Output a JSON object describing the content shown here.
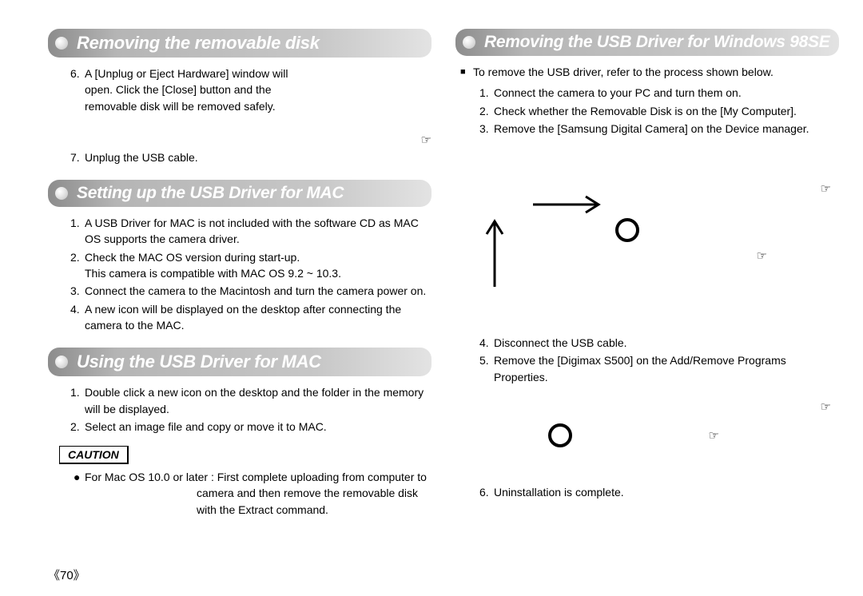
{
  "page_number_display": "《70》",
  "left": {
    "s1": {
      "title": "Removing the removable disk",
      "i6n": "6.",
      "i6": "A [Unplug or Eject Hardware] window will open. Click the [Close] button and the removable disk will be removed safely.",
      "i7n": "7.",
      "i7": "Unplug the USB cable."
    },
    "s2": {
      "title": "Setting up the USB Driver for MAC",
      "i1n": "1.",
      "i1": "A USB Driver for MAC is not included with the software CD as MAC OS supports the camera driver.",
      "i2n": "2.",
      "i2a": "Check the MAC OS version during start-up.",
      "i2b": "This camera is compatible with MAC OS 9.2 ~ 10.3.",
      "i3n": "3.",
      "i3": "Connect the camera to the Macintosh and turn the camera power on.",
      "i4n": "4.",
      "i4": "A new icon will be displayed on the desktop after connecting the camera to the MAC."
    },
    "s3": {
      "title": "Using the USB Driver for MAC",
      "i1n": "1.",
      "i1": "Double click a new icon on the desktop and the folder in the memory will be displayed.",
      "i2n": "2.",
      "i2": "Select an image file and copy or move it to MAC."
    },
    "caution": {
      "label": "CAUTION",
      "bullet": "●",
      "line1": "For Mac OS 10.0 or later : First complete uploading from computer to",
      "line2": "camera and then remove the removable disk",
      "line3": "with the Extract command."
    }
  },
  "right": {
    "s1": {
      "title": "Removing the USB Driver for Windows 98SE",
      "lead_sq": "■",
      "lead": "To remove the USB driver, refer to the process shown below.",
      "i1n": "1.",
      "i1": "Connect the camera to your PC and turn them on.",
      "i2n": "2.",
      "i2": "Check whether the Removable Disk is on the [My Computer].",
      "i3n": "3.",
      "i3": "Remove the [Samsung Digital Camera] on the Device manager.",
      "i4n": "4.",
      "i4": "Disconnect the USB cable.",
      "i5n": "5.",
      "i5": "Remove the [Digimax S500] on the Add/Remove Programs Properties.",
      "i6n": "6.",
      "i6": "Uninstallation is complete."
    }
  },
  "icons": {
    "hand": "☞"
  }
}
